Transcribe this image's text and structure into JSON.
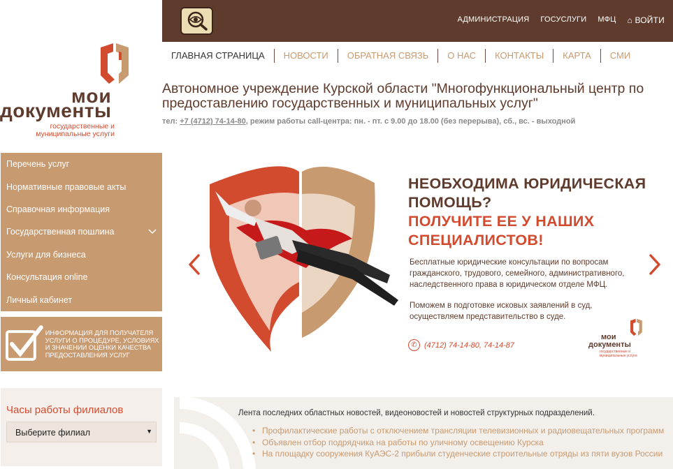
{
  "topbar": {
    "nav": [
      "АДМИНИСТРАЦИЯ",
      "ГОСУСЛУГИ",
      "МФЦ"
    ],
    "login": "ВОЙТИ"
  },
  "logo": {
    "line1": "мои",
    "line2": "документы",
    "sub": "государственные и муниципальные услуги"
  },
  "main_nav": [
    "ГЛАВНАЯ СТРАНИЦА",
    "НОВОСТИ",
    "ОБРАТНАЯ СВЯЗЬ",
    "О НАС",
    "КОНТАКТЫ",
    "КАРТА",
    "СМИ"
  ],
  "org_title": "Автономное учреждение Курской области \"Многофункциональный центр по предоставлению государственных и муниципальных услуг\"",
  "contact": {
    "prefix": "тел: ",
    "phone": "+7 (4712) 74-14-80",
    "suffix": ", режим работы call-центра: пн. - пт. с 9.00 до 18.00 (без перерыва), сб., вс. - выходной"
  },
  "sidebar": {
    "items": [
      {
        "label": "Перечень услуг"
      },
      {
        "label": "Нормативные правовые акты"
      },
      {
        "label": "Справочная информация"
      },
      {
        "label": "Государственная пошлина"
      },
      {
        "label": "Услуги для бизнеса"
      },
      {
        "label": "Консультация online"
      },
      {
        "label": "Личный кабинет"
      }
    ],
    "quality_banner": "ИНФОРМАЦИЯ ДЛЯ ПОЛУЧАТЕЛЯ УСЛУГИ О ПРОЦЕДУРЕ, УСЛОВИЯХ И ЗНАЧЕНИИ ОЦЕНКИ КАЧЕСТВА ПРЕДОСТАВЛЕНИЯ УСЛУГ"
  },
  "branches": {
    "title": "Часы работы филиалов",
    "select_value": "Выберите филиал"
  },
  "slider": {
    "heading1": "НЕОБХОДИМА ЮРИДИЧЕСКАЯ ПОМОЩЬ?",
    "heading2": "ПОЛУЧИТЕ ЕЕ У НАШИХ СПЕЦИАЛИСТОВ!",
    "paragraph1": "Бесплатные юридические консультации по вопросам гражданского, трудового, семейного, административного, наследственного права в юридическом отделе МФЦ.",
    "paragraph2": "Поможем в подготовке исковых заявлений в суд, осуществляем представительство в суде.",
    "phone": "(4712) 74-14-80, 74-14-87",
    "mini_logo1": "мои",
    "mini_logo2": "документы",
    "mini_logo3": "государственные и муниципальные услуги"
  },
  "news": {
    "intro": "Лента последних областных новостей, видеоновостей и новостей структурных подразделений.",
    "items": [
      "Профилактические работы с отключением трансляции телевизионных и радиовещательных программ",
      "Объявлен отбор подрядчика на работы по уличному освещению Курска",
      "На площадку сооружения КуАЭС-2 прибыли студенческие строительные отряды из пяти вузов России"
    ]
  },
  "colors": {
    "brown": "#5e3b2c",
    "tan": "#c89a70",
    "red": "#d34b2f"
  },
  "icons": [
    "search-eye-icon",
    "home-icon",
    "chevron-down-icon",
    "checkbox-icon",
    "arrow-left-icon",
    "arrow-right-icon",
    "phone-icon",
    "rss-icon"
  ]
}
